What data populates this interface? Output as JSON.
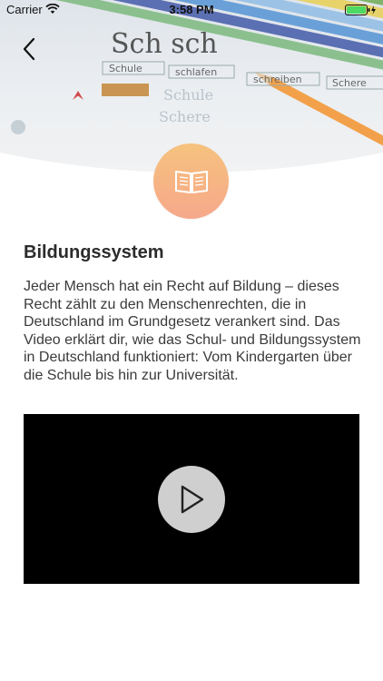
{
  "status_bar": {
    "carrier": "Carrier",
    "time": "3:58 PM",
    "battery_level": 1.0,
    "battery_color": "#4cd964"
  },
  "navigation": {
    "back_icon": "chevron-left-icon"
  },
  "hero": {
    "photo_words": [
      "Sch sch",
      "Schule",
      "schlafen",
      "schreiben",
      "Schere",
      "Schule",
      "Schere"
    ],
    "badge_icon": "open-book-icon",
    "badge_colors": [
      "#f6c27e",
      "#f6a88a"
    ]
  },
  "article": {
    "title": "Bildungssystem",
    "body": "Jeder Mensch hat ein Recht auf Bildung – dieses Recht zählt zu den Menschenrechten, die in Deutschland im Grundgesetz verankert sind. Das Video erklärt dir, wie das Schul- und Bildungssystem in Deutschland funktioniert: Vom Kindergarten über die Schule bis hin zur Universität."
  },
  "video": {
    "play_icon": "play-icon",
    "background_color": "#000000"
  }
}
